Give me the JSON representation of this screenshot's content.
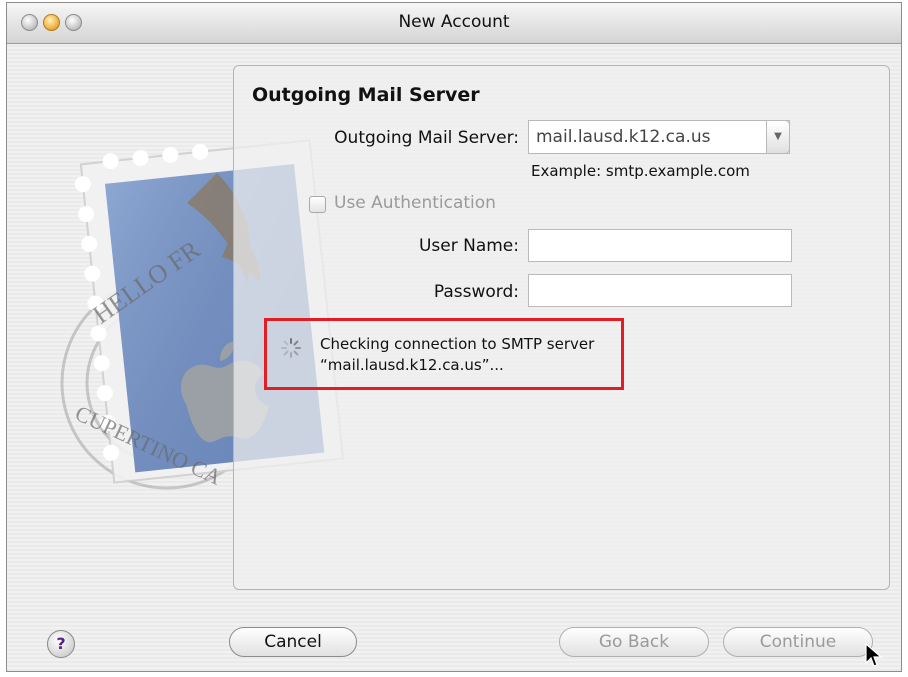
{
  "window": {
    "title": "New Account"
  },
  "panel": {
    "section_title": "Outgoing Mail Server",
    "outgoing_server_label": "Outgoing Mail Server:",
    "outgoing_server_value": "mail.lausd.k12.ca.us",
    "example_text": "Example: smtp.example.com",
    "use_auth_label": "Use Authentication",
    "use_auth_checked": false,
    "username_label": "User Name:",
    "username_value": "",
    "password_label": "Password:",
    "password_value": ""
  },
  "status": {
    "line1": "Checking connection to SMTP server",
    "line2": "“mail.lausd.k12.ca.us”..."
  },
  "buttons": {
    "help_label": "?",
    "cancel_label": "Cancel",
    "go_back_label": "Go Back",
    "continue_label": "Continue"
  },
  "stamp": {
    "postmark_top": "HELLO FR",
    "postmark_bottom": "CUPERTINO CA"
  },
  "colors": {
    "highlight_box": "#e01e24",
    "stamp_blue": "#5a7fc0"
  },
  "icons": [
    "window-close-icon",
    "window-minimize-icon",
    "window-zoom-icon",
    "combo-dropdown-icon",
    "spinner-icon",
    "help-icon",
    "mouse-cursor-icon",
    "mail-stamp-icon"
  ]
}
